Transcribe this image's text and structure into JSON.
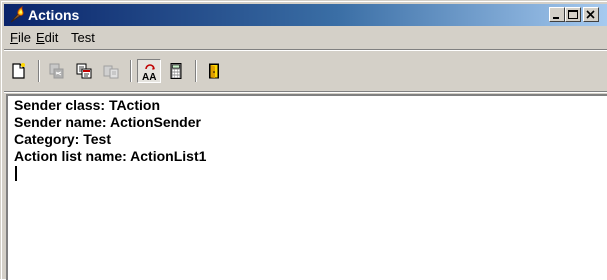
{
  "window": {
    "title": "Actions",
    "icon": "torch-icon",
    "controls": [
      "minimize-icon",
      "maximize-icon",
      "close-icon"
    ]
  },
  "menu": {
    "file": {
      "accel": "F",
      "rest": "ile"
    },
    "edit": {
      "accel": "E",
      "rest": "dit"
    },
    "test": {
      "label": "Test"
    }
  },
  "toolbar": {
    "buttons": [
      {
        "icon": "new-document-icon",
        "enabled": true,
        "pressed": false
      },
      {
        "icon": "cut-icon",
        "enabled": false,
        "pressed": false
      },
      {
        "icon": "copy-icon",
        "enabled": true,
        "pressed": false
      },
      {
        "icon": "paste-icon",
        "enabled": false,
        "pressed": false
      },
      {
        "icon": "font-aa-icon",
        "enabled": true,
        "pressed": true
      },
      {
        "icon": "calculator-icon",
        "enabled": true,
        "pressed": false
      },
      {
        "icon": "exit-door-icon",
        "enabled": true,
        "pressed": false
      }
    ]
  },
  "editor": {
    "lines": [
      "Sender class: TAction",
      "Sender name: ActionSender",
      "Category: Test",
      "Action list name: ActionList1"
    ]
  },
  "colors": {
    "title_gradient_start": "#0a246a",
    "title_gradient_end": "#a6caf0",
    "face": "#d4d0c8",
    "editor_bg": "#ffffff"
  }
}
